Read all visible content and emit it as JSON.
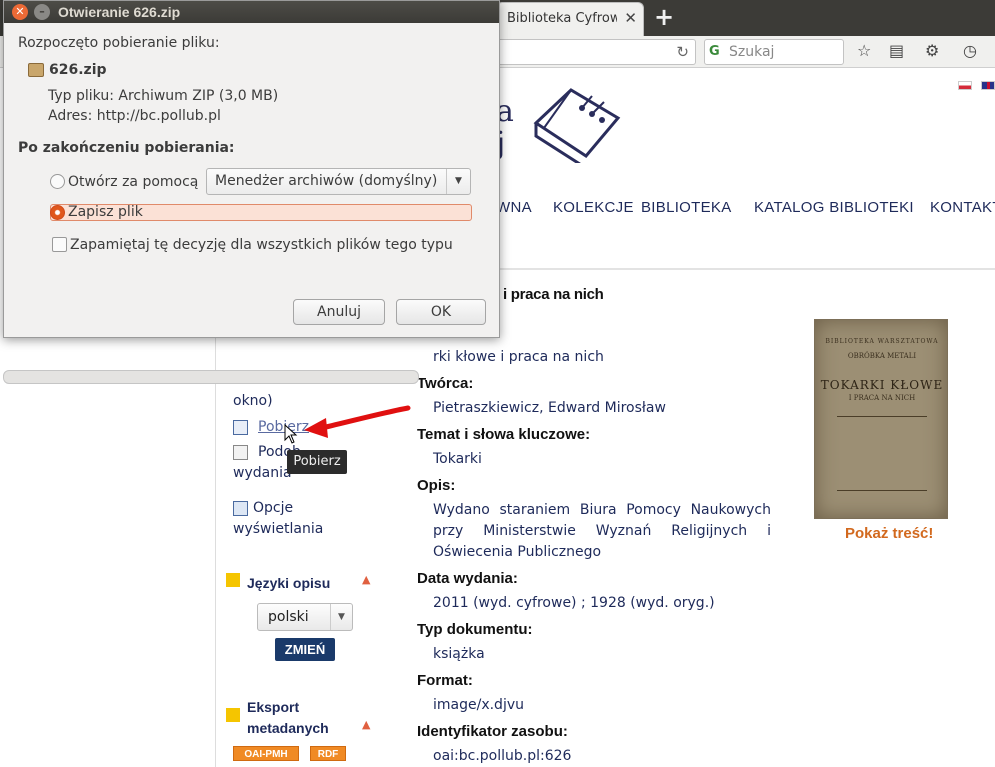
{
  "browser": {
    "tab_title": "Biblioteka Cyfrowa ...",
    "search_placeholder": "Szukaj"
  },
  "page": {
    "nav": [
      "GŁÓWNA",
      "KOLEKCJE",
      "BIBLIOTEKA",
      "KATALOG BIBLIOTEKI",
      "KONTAKT"
    ],
    "nav_first_fragment": "WNA",
    "logo_fragment": "a\nj",
    "title_fragment": "i praca na nich",
    "title_line_fragment": "rki kłowe i praca na nich",
    "sidebar": {
      "okno_fragment": "okno)",
      "pobierz": "Pobierz",
      "podobne_fragment": "Podob",
      "wydania": "wydania",
      "opcje_line1": "Opcje",
      "opcje_line2": "wyświetlania",
      "jezyki_heading": "Języki opisu",
      "lang_selected": "polski",
      "zmien": "ZMIEŃ",
      "eksport_line1": "Eksport",
      "eksport_line2": "metadanych",
      "oai": "OAI-PMH",
      "rdf": "RDF"
    },
    "metadata": {
      "tworca_label": "Twórca:",
      "tworca_value": "Pietraszkiewicz, Edward Mirosław",
      "temat_label": "Temat i słowa kluczowe:",
      "temat_value": "Tokarki",
      "opis_label": "Opis:",
      "opis_value": "Wydano staraniem Biura Pomocy Naukowych przy Ministerstwie Wyznań Religijnych i Oświecenia Publicznego",
      "data_label": "Data wydania:",
      "data_value": "2011 (wyd. cyfrowe) ; 1928 (wyd. oryg.)",
      "typ_label": "Typ dokumentu:",
      "typ_value": "książka",
      "format_label": "Format:",
      "format_value": "image/x.djvu",
      "ident_label": "Identyfikator zasobu:",
      "ident_value": "oai:bc.pollub.pl:626"
    },
    "cover": {
      "line1": "BIBLIOTEKA WARSZTATOWA",
      "line2": "OBRÓBKA METALI",
      "line3": "TOKARKI KŁOWE",
      "line4": "I PRACA NA NICH"
    },
    "show_content": "Pokaż treść!",
    "tooltip": "Pobierz"
  },
  "dialog": {
    "title": "Otwieranie 626.zip",
    "started": "Rozpoczęto pobieranie pliku:",
    "filename": "626.zip",
    "filetype": "Typ pliku:  Archiwum ZIP (3,0 MB)",
    "address": "Adres:  http://bc.pollub.pl",
    "after_heading": "Po zakończeniu pobierania:",
    "open_with": "Otwórz za pomocą",
    "app_selected": "Menedżer archiwów (domyślny)",
    "save_file": "Zapisz plik",
    "remember": "Zapamiętaj tę decyzję dla wszystkich plików tego typu",
    "cancel": "Anuluj",
    "ok": "OK",
    "selected_option": "save"
  },
  "colors": {
    "accent": "#e0571c",
    "nav_text": "#1e2a5a",
    "link_orange": "#d2691e",
    "annotation": "#e01010"
  }
}
